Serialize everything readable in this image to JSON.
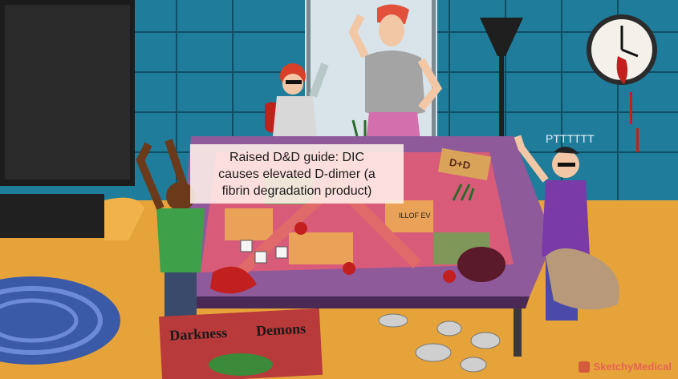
{
  "caption": {
    "line1": "Raised D&D guide: DIC",
    "line2": "causes elevated D-dimer (a",
    "line3": "fibrin degradation product)"
  },
  "sign": {
    "text": "D+D"
  },
  "sound_effect": {
    "text": "PTTTTTT"
  },
  "board_label": {
    "text": "ILLOF EV"
  },
  "book": {
    "title_1": "Darkness",
    "title_2": "Demons"
  },
  "watermark": {
    "text": "SketchyMedical"
  },
  "colors": {
    "wall": "#1f7c9a",
    "floor": "#e6a33a",
    "table": "#8e5a9a",
    "caption_bg": "#fff0eb",
    "blood": "#c21f1f"
  }
}
